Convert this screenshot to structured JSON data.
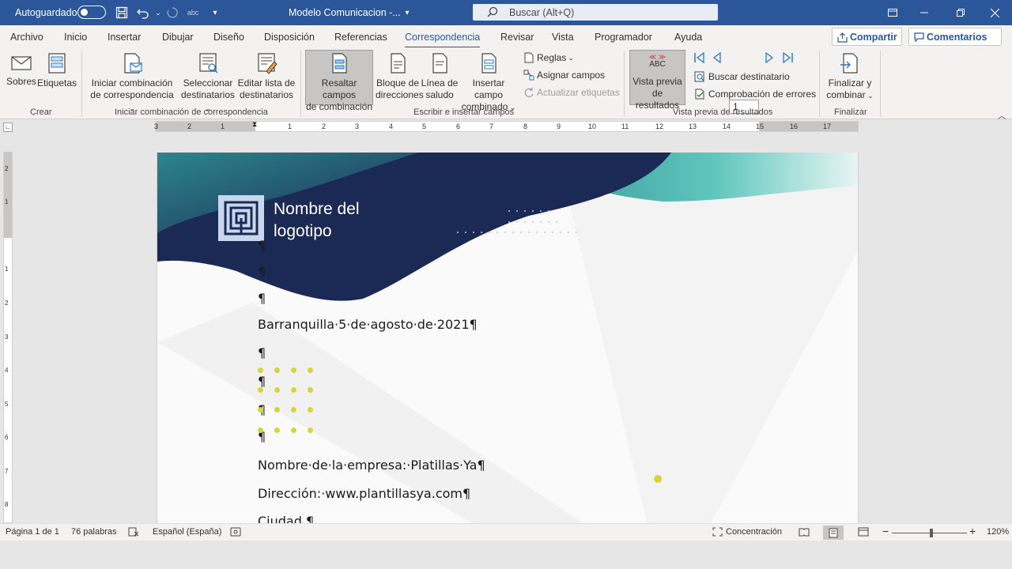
{
  "titlebar": {
    "autosave_label": "Autoguardado",
    "doc_title": "Modelo Comunicacion  -...",
    "search_placeholder": "Buscar (Alt+Q)"
  },
  "menu": {
    "tabs": [
      "Archivo",
      "Inicio",
      "Insertar",
      "Dibujar",
      "Diseño",
      "Disposición",
      "Referencias",
      "Correspondencia",
      "Revisar",
      "Vista",
      "Programador",
      "Ayuda"
    ],
    "active": "Correspondencia",
    "share": "Compartir",
    "comments": "Comentarios"
  },
  "ribbon": {
    "crear": {
      "label": "Crear",
      "sobres": "Sobres",
      "etiquetas": "Etiquetas"
    },
    "iniciar": {
      "label": "Iniciar combinación de correspondencia",
      "iniciar_1": "Iniciar combinación",
      "iniciar_2": "de correspondencia",
      "sel_1": "Seleccionar",
      "sel_2": "destinatarios",
      "edit_1": "Editar lista de",
      "edit_2": "destinatarios"
    },
    "escribir": {
      "label": "Escribir e insertar campos",
      "resaltar_1": "Resaltar campos",
      "resaltar_2": "de combinación",
      "bloque_1": "Bloque de",
      "bloque_2": "direcciones",
      "linea_1": "Línea de",
      "linea_2": "saludo",
      "insertar_1": "Insertar campo",
      "insertar_2": "combinado",
      "reglas": "Reglas",
      "asignar": "Asignar campos",
      "actualizar": "Actualizar etiquetas"
    },
    "vista": {
      "label": "Vista previa de resultados",
      "abc": "ABC",
      "vista_1": "Vista previa",
      "vista_2": "de resultados",
      "record": "1",
      "buscar": "Buscar destinatario",
      "comprobacion": "Comprobación de errores"
    },
    "finalizar": {
      "label": "Finalizar",
      "fin_1": "Finalizar y",
      "fin_2": "combinar"
    }
  },
  "ruler": {
    "numbers": [
      "3",
      "2",
      "1",
      "1",
      "2",
      "3",
      "4",
      "5",
      "6",
      "7",
      "8",
      "9",
      "10",
      "11",
      "12",
      "13",
      "14",
      "15",
      "16",
      "17"
    ],
    "vnumbers": [
      "2",
      "1",
      "1",
      "2",
      "3",
      "4",
      "5",
      "6",
      "7",
      "8"
    ]
  },
  "document": {
    "logo_line1": "Nombre del",
    "logo_line2": "logotipo",
    "pilcrow": "¶",
    "date": "Barranquilla·5·de·agosto·de·2021¶",
    "company": "Nombre·de·la·empresa:·Platillas·Ya¶",
    "address": "Dirección:·www.plantillasya.com¶",
    "city": "Ciudad.¶"
  },
  "status": {
    "page": "Página 1 de 1",
    "words": "76 palabras",
    "language": "Español (España)",
    "focus": "Concentración",
    "zoom": "120%",
    "zoom_minus": "−",
    "zoom_plus": "+"
  },
  "colors": {
    "accent": "#2b579a",
    "navy": "#1b2a55",
    "teal": "#5fc6bd",
    "highlight_dots": "#d6d63a"
  }
}
